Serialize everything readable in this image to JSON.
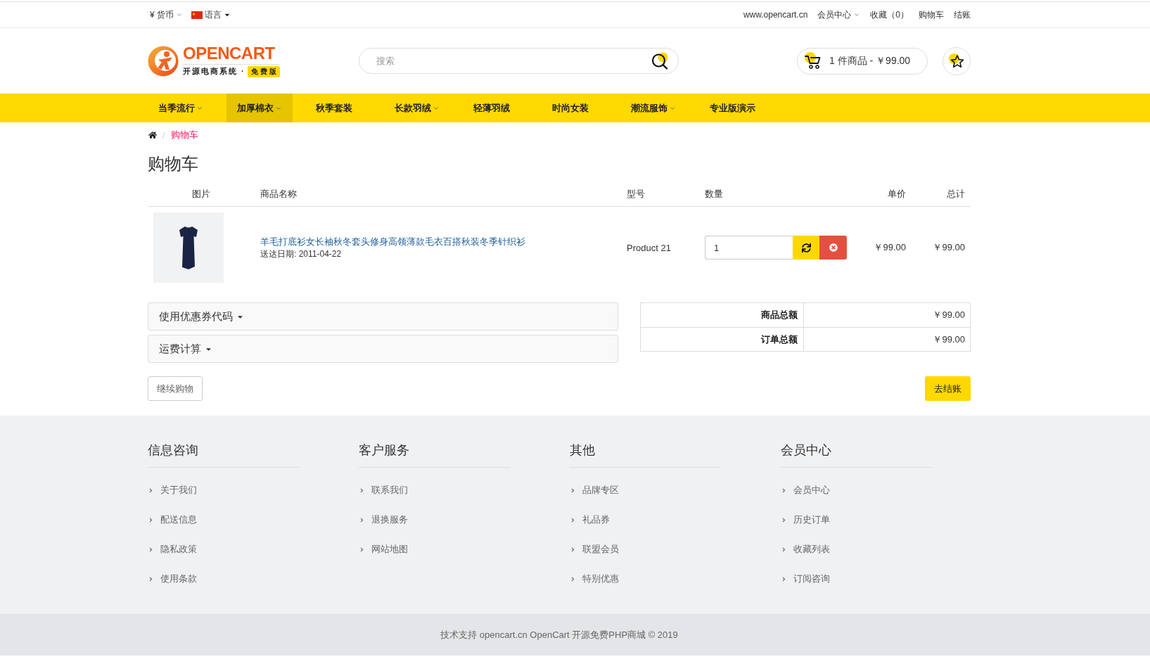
{
  "top_bar": {
    "currency": "¥ 货币",
    "language": "语言",
    "links": [
      {
        "label": "www.opencart.cn",
        "dropdown": false
      },
      {
        "label": "会员中心",
        "dropdown": true
      },
      {
        "label": "收藏（0）",
        "dropdown": false
      },
      {
        "label": "购物车",
        "dropdown": false
      },
      {
        "label": "结账",
        "dropdown": false
      }
    ]
  },
  "header": {
    "logo": {
      "wordmark": "OPENCART",
      "tagline": "开源电商系统 ·",
      "badge": "免费版"
    },
    "search": {
      "placeholder": "搜索"
    },
    "cart_button": {
      "label": "1 件商品 - ￥99.00"
    }
  },
  "nav": [
    {
      "label": "当季流行",
      "dropdown": true,
      "selected": false
    },
    {
      "label": "加厚棉衣",
      "dropdown": true,
      "selected": true
    },
    {
      "label": "秋季套装",
      "dropdown": false,
      "selected": false
    },
    {
      "label": "长款羽绒",
      "dropdown": true,
      "selected": false
    },
    {
      "label": "轻薄羽绒",
      "dropdown": false,
      "selected": false
    },
    {
      "label": "时尚女装",
      "dropdown": false,
      "selected": false
    },
    {
      "label": "潮流服饰",
      "dropdown": true,
      "selected": false
    },
    {
      "label": "专业版演示",
      "dropdown": false,
      "selected": false
    }
  ],
  "breadcrumb": {
    "separator": "/",
    "current": "购物车"
  },
  "page_title": "购物车",
  "cart_table": {
    "columns": [
      "图片",
      "商品名称",
      "型号",
      "数量",
      "单价",
      "总计"
    ],
    "rows": [
      {
        "name": "羊毛打底衫女长袖秋冬套头修身高领薄款毛衣百搭秋装冬季针织衫",
        "delivery": "送达日期: 2011-04-22",
        "model": "Product 21",
        "quantity": "1",
        "unit_price": "￥99.00",
        "total": "￥99.00"
      }
    ]
  },
  "panels": [
    {
      "title": "使用优惠券代码"
    },
    {
      "title": "运费计算"
    }
  ],
  "totals": [
    {
      "label": "商品总额",
      "value": "￥99.00"
    },
    {
      "label": "订单总额",
      "value": "￥99.00"
    }
  ],
  "actions": {
    "continue": "继续购物",
    "checkout": "去结账"
  },
  "footer": {
    "columns": [
      {
        "title": "信息咨询",
        "links": [
          "关于我们",
          "配送信息",
          "隐私政策",
          "使用条款"
        ]
      },
      {
        "title": "客户服务",
        "links": [
          "联系我们",
          "退换服务",
          "网站地图"
        ]
      },
      {
        "title": "其他",
        "links": [
          "品牌专区",
          "礼品券",
          "联盟会员",
          "特别优惠"
        ]
      },
      {
        "title": "会员中心",
        "links": [
          "会员中心",
          "历史订单",
          "收藏列表",
          "订阅咨询"
        ]
      }
    ],
    "copyright": "技术支持 opencart.cn OpenCart 开源免费PHP商城 © 2019"
  }
}
